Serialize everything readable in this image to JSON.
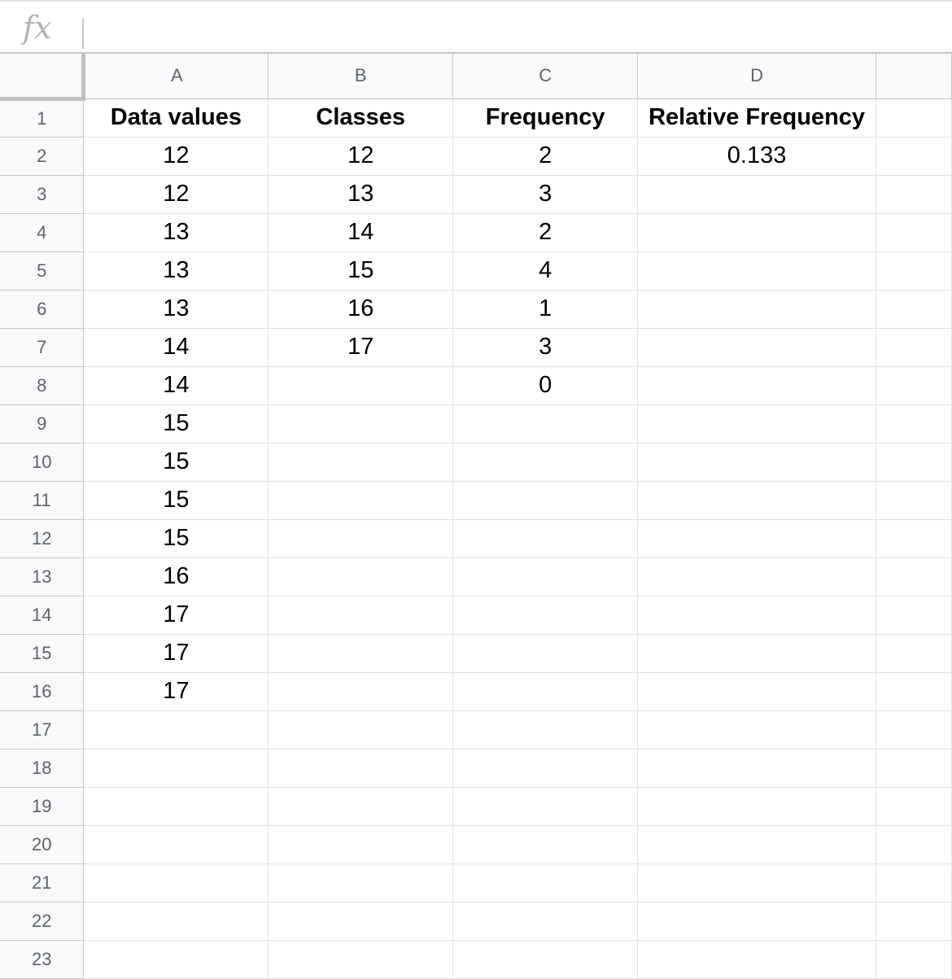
{
  "formula_bar": {
    "icon": "fx-icon",
    "value": ""
  },
  "columns": [
    "A",
    "B",
    "C",
    "D",
    ""
  ],
  "rows": [
    {
      "num": "1",
      "cells": [
        "Data values",
        "Classes",
        "Frequency",
        "Relative Frequency",
        ""
      ]
    },
    {
      "num": "2",
      "cells": [
        "12",
        "12",
        "2",
        "0.133",
        ""
      ]
    },
    {
      "num": "3",
      "cells": [
        "12",
        "13",
        "3",
        "",
        ""
      ]
    },
    {
      "num": "4",
      "cells": [
        "13",
        "14",
        "2",
        "",
        ""
      ]
    },
    {
      "num": "5",
      "cells": [
        "13",
        "15",
        "4",
        "",
        ""
      ]
    },
    {
      "num": "6",
      "cells": [
        "13",
        "16",
        "1",
        "",
        ""
      ]
    },
    {
      "num": "7",
      "cells": [
        "14",
        "17",
        "3",
        "",
        ""
      ]
    },
    {
      "num": "8",
      "cells": [
        "14",
        "",
        "0",
        "",
        ""
      ]
    },
    {
      "num": "9",
      "cells": [
        "15",
        "",
        "",
        "",
        ""
      ]
    },
    {
      "num": "10",
      "cells": [
        "15",
        "",
        "",
        "",
        ""
      ]
    },
    {
      "num": "11",
      "cells": [
        "15",
        "",
        "",
        "",
        ""
      ]
    },
    {
      "num": "12",
      "cells": [
        "15",
        "",
        "",
        "",
        ""
      ]
    },
    {
      "num": "13",
      "cells": [
        "16",
        "",
        "",
        "",
        ""
      ]
    },
    {
      "num": "14",
      "cells": [
        "17",
        "",
        "",
        "",
        ""
      ]
    },
    {
      "num": "15",
      "cells": [
        "17",
        "",
        "",
        "",
        ""
      ]
    },
    {
      "num": "16",
      "cells": [
        "17",
        "",
        "",
        "",
        ""
      ]
    },
    {
      "num": "17",
      "cells": [
        "",
        "",
        "",
        "",
        ""
      ]
    },
    {
      "num": "18",
      "cells": [
        "",
        "",
        "",
        "",
        ""
      ]
    },
    {
      "num": "19",
      "cells": [
        "",
        "",
        "",
        "",
        ""
      ]
    },
    {
      "num": "20",
      "cells": [
        "",
        "",
        "",
        "",
        ""
      ]
    },
    {
      "num": "21",
      "cells": [
        "",
        "",
        "",
        "",
        ""
      ]
    },
    {
      "num": "22",
      "cells": [
        "",
        "",
        "",
        "",
        ""
      ]
    },
    {
      "num": "23",
      "cells": [
        "",
        "",
        "",
        "",
        ""
      ]
    }
  ]
}
